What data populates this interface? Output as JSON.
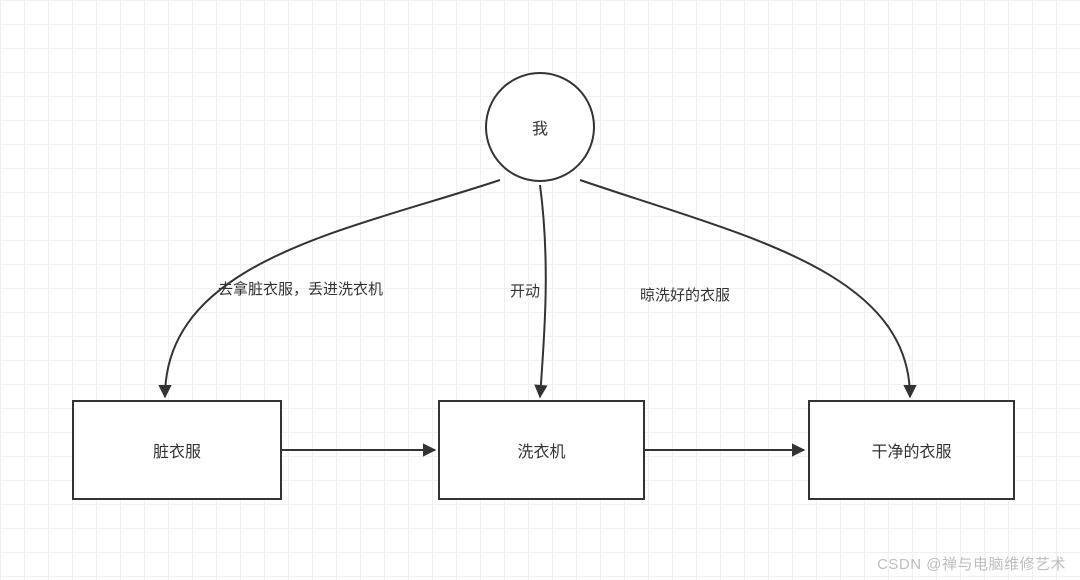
{
  "nodes": {
    "actor": {
      "label": "我"
    },
    "dirty_clothes": {
      "label": "脏衣服"
    },
    "washer": {
      "label": "洗衣机"
    },
    "clean_clothes": {
      "label": "干净的衣服"
    }
  },
  "edges": {
    "actor_to_dirty": {
      "label": "去拿脏衣服，丢进洗衣机"
    },
    "actor_to_washer": {
      "label": "开动"
    },
    "actor_to_clean": {
      "label": "晾洗好的衣服"
    }
  },
  "watermark": "CSDN @禅与电脑维修艺术",
  "stroke": "#333333"
}
